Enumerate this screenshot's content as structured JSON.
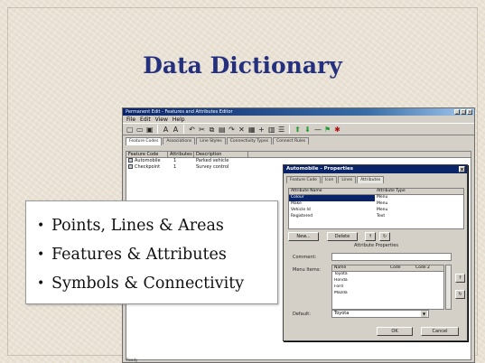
{
  "slide": {
    "title": "Data Dictionary"
  },
  "app": {
    "window_title": "Permanent Edit - Features and Attributes Editor",
    "menu": [
      "File",
      "Edit",
      "View",
      "Help"
    ],
    "toolbar_icons": [
      "new-icon",
      "open-icon",
      "save-icon",
      "text-icon",
      "text-alt-icon",
      "undo-icon",
      "cut-icon",
      "copy-icon",
      "paste-icon",
      "redo-icon",
      "delete-icon",
      "properties-icon",
      "add-icon",
      "grid-icon",
      "list-icon",
      "green-arrow-up-icon",
      "green-arrow-down-icon",
      "minus-icon",
      "flag-icon",
      "link-icon"
    ],
    "tabs": [
      "Feature Codes",
      "Associations",
      "Line Styles",
      "Connectivity Types",
      "Connect Rules"
    ],
    "columns": [
      "Feature Code",
      "Attributes",
      "Description"
    ],
    "rows": [
      {
        "code": "Automobile",
        "attributes": "1",
        "description": "Parked vehicle"
      },
      {
        "code": "Checkpoint",
        "attributes": "1",
        "description": "Survey control"
      }
    ],
    "status": "Ready"
  },
  "dialog": {
    "title": "Automobile - Properties",
    "close_label": "x",
    "tabs": [
      "Feature Code",
      "Icon",
      "Lines",
      "Attributes"
    ],
    "attr_columns": [
      "Attribute Name",
      "Attribute Type"
    ],
    "attr_rows": [
      {
        "name": "Colour",
        "type": "Menu"
      },
      {
        "name": "Make",
        "type": "Menu"
      },
      {
        "name": "Vehicle Id",
        "type": "Menu"
      },
      {
        "name": "Registered",
        "type": "Text"
      }
    ],
    "buttons": {
      "new": "New...",
      "delete": "Delete",
      "ok": "OK",
      "cancel": "Cancel"
    },
    "group_label": "Attribute Properties",
    "comment_label": "Comment:",
    "menu_items_label": "Menu Items:",
    "menu_columns": [
      "Name",
      "Code",
      "Code 2"
    ],
    "menu_rows": [
      "Toyota",
      "Honda",
      "Ford",
      "Mazda"
    ],
    "default_label": "Default:",
    "default_value": "Toyota"
  },
  "bullets": [
    "Points, Lines & Areas",
    "Features & Attributes",
    "Symbols & Connectivity"
  ]
}
